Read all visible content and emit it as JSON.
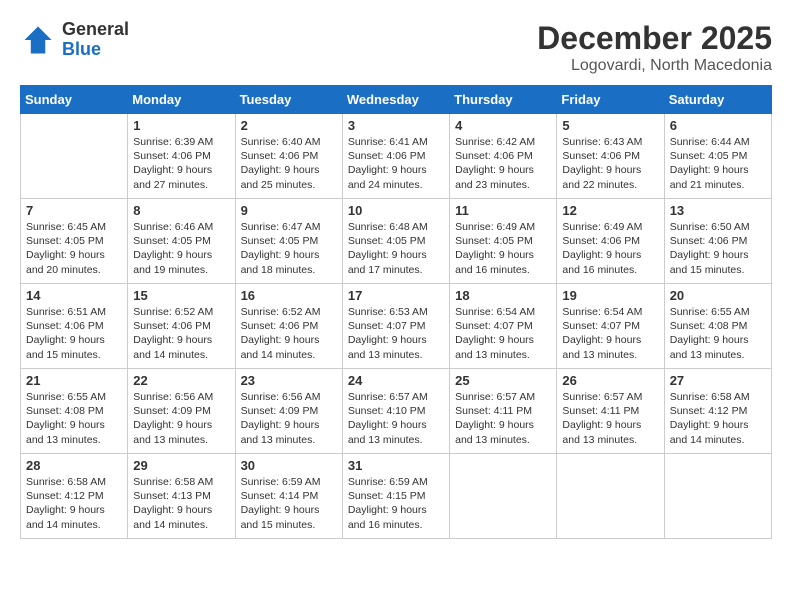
{
  "header": {
    "logo_general": "General",
    "logo_blue": "Blue",
    "month_title": "December 2025",
    "subtitle": "Logovardi, North Macedonia"
  },
  "days_of_week": [
    "Sunday",
    "Monday",
    "Tuesday",
    "Wednesday",
    "Thursday",
    "Friday",
    "Saturday"
  ],
  "weeks": [
    [
      {
        "day": "",
        "info": ""
      },
      {
        "day": "1",
        "info": "Sunrise: 6:39 AM\nSunset: 4:06 PM\nDaylight: 9 hours\nand 27 minutes."
      },
      {
        "day": "2",
        "info": "Sunrise: 6:40 AM\nSunset: 4:06 PM\nDaylight: 9 hours\nand 25 minutes."
      },
      {
        "day": "3",
        "info": "Sunrise: 6:41 AM\nSunset: 4:06 PM\nDaylight: 9 hours\nand 24 minutes."
      },
      {
        "day": "4",
        "info": "Sunrise: 6:42 AM\nSunset: 4:06 PM\nDaylight: 9 hours\nand 23 minutes."
      },
      {
        "day": "5",
        "info": "Sunrise: 6:43 AM\nSunset: 4:06 PM\nDaylight: 9 hours\nand 22 minutes."
      },
      {
        "day": "6",
        "info": "Sunrise: 6:44 AM\nSunset: 4:05 PM\nDaylight: 9 hours\nand 21 minutes."
      }
    ],
    [
      {
        "day": "7",
        "info": "Sunrise: 6:45 AM\nSunset: 4:05 PM\nDaylight: 9 hours\nand 20 minutes."
      },
      {
        "day": "8",
        "info": "Sunrise: 6:46 AM\nSunset: 4:05 PM\nDaylight: 9 hours\nand 19 minutes."
      },
      {
        "day": "9",
        "info": "Sunrise: 6:47 AM\nSunset: 4:05 PM\nDaylight: 9 hours\nand 18 minutes."
      },
      {
        "day": "10",
        "info": "Sunrise: 6:48 AM\nSunset: 4:05 PM\nDaylight: 9 hours\nand 17 minutes."
      },
      {
        "day": "11",
        "info": "Sunrise: 6:49 AM\nSunset: 4:05 PM\nDaylight: 9 hours\nand 16 minutes."
      },
      {
        "day": "12",
        "info": "Sunrise: 6:49 AM\nSunset: 4:06 PM\nDaylight: 9 hours\nand 16 minutes."
      },
      {
        "day": "13",
        "info": "Sunrise: 6:50 AM\nSunset: 4:06 PM\nDaylight: 9 hours\nand 15 minutes."
      }
    ],
    [
      {
        "day": "14",
        "info": "Sunrise: 6:51 AM\nSunset: 4:06 PM\nDaylight: 9 hours\nand 15 minutes."
      },
      {
        "day": "15",
        "info": "Sunrise: 6:52 AM\nSunset: 4:06 PM\nDaylight: 9 hours\nand 14 minutes."
      },
      {
        "day": "16",
        "info": "Sunrise: 6:52 AM\nSunset: 4:06 PM\nDaylight: 9 hours\nand 14 minutes."
      },
      {
        "day": "17",
        "info": "Sunrise: 6:53 AM\nSunset: 4:07 PM\nDaylight: 9 hours\nand 13 minutes."
      },
      {
        "day": "18",
        "info": "Sunrise: 6:54 AM\nSunset: 4:07 PM\nDaylight: 9 hours\nand 13 minutes."
      },
      {
        "day": "19",
        "info": "Sunrise: 6:54 AM\nSunset: 4:07 PM\nDaylight: 9 hours\nand 13 minutes."
      },
      {
        "day": "20",
        "info": "Sunrise: 6:55 AM\nSunset: 4:08 PM\nDaylight: 9 hours\nand 13 minutes."
      }
    ],
    [
      {
        "day": "21",
        "info": "Sunrise: 6:55 AM\nSunset: 4:08 PM\nDaylight: 9 hours\nand 13 minutes."
      },
      {
        "day": "22",
        "info": "Sunrise: 6:56 AM\nSunset: 4:09 PM\nDaylight: 9 hours\nand 13 minutes."
      },
      {
        "day": "23",
        "info": "Sunrise: 6:56 AM\nSunset: 4:09 PM\nDaylight: 9 hours\nand 13 minutes."
      },
      {
        "day": "24",
        "info": "Sunrise: 6:57 AM\nSunset: 4:10 PM\nDaylight: 9 hours\nand 13 minutes."
      },
      {
        "day": "25",
        "info": "Sunrise: 6:57 AM\nSunset: 4:11 PM\nDaylight: 9 hours\nand 13 minutes."
      },
      {
        "day": "26",
        "info": "Sunrise: 6:57 AM\nSunset: 4:11 PM\nDaylight: 9 hours\nand 13 minutes."
      },
      {
        "day": "27",
        "info": "Sunrise: 6:58 AM\nSunset: 4:12 PM\nDaylight: 9 hours\nand 14 minutes."
      }
    ],
    [
      {
        "day": "28",
        "info": "Sunrise: 6:58 AM\nSunset: 4:12 PM\nDaylight: 9 hours\nand 14 minutes."
      },
      {
        "day": "29",
        "info": "Sunrise: 6:58 AM\nSunset: 4:13 PM\nDaylight: 9 hours\nand 14 minutes."
      },
      {
        "day": "30",
        "info": "Sunrise: 6:59 AM\nSunset: 4:14 PM\nDaylight: 9 hours\nand 15 minutes."
      },
      {
        "day": "31",
        "info": "Sunrise: 6:59 AM\nSunset: 4:15 PM\nDaylight: 9 hours\nand 16 minutes."
      },
      {
        "day": "",
        "info": ""
      },
      {
        "day": "",
        "info": ""
      },
      {
        "day": "",
        "info": ""
      }
    ]
  ]
}
